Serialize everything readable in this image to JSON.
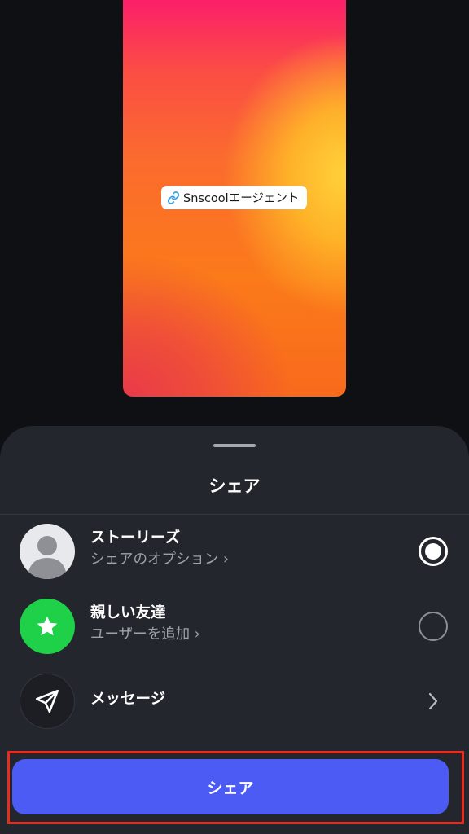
{
  "story_preview": {
    "link_sticker_text": "Snscoolエージェント"
  },
  "sheet": {
    "title": "シェア",
    "options": [
      {
        "title": "ストーリーズ",
        "subtitle": "シェアのオプション ›",
        "selected": true,
        "icon": "avatar-icon"
      },
      {
        "title": "親しい友達",
        "subtitle": "ユーザーを追加 ›",
        "selected": false,
        "icon": "star-icon"
      },
      {
        "title": "メッセージ",
        "icon": "send-icon"
      }
    ],
    "share_button_label": "シェア"
  },
  "colors": {
    "sheet_background": "#23262d",
    "share_button": "#4c5bf3",
    "close_friends_green": "#1fd148",
    "highlight_box": "#e62c1c"
  }
}
